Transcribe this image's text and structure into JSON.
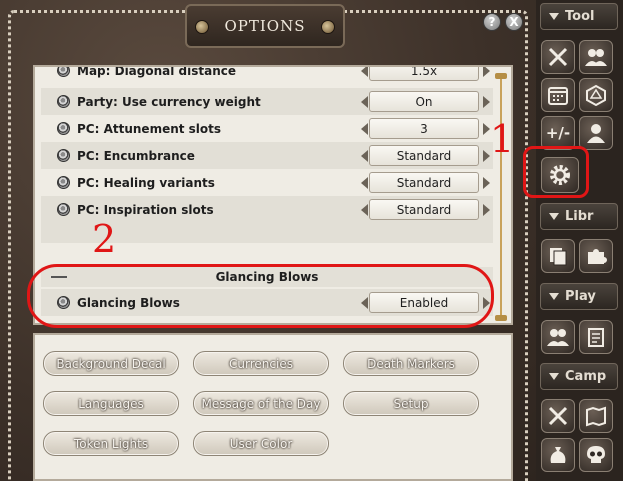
{
  "window": {
    "title": "OPTIONS",
    "help_label": "?",
    "close_label": "X"
  },
  "options_list": {
    "rows": [
      {
        "label": "Map: Diagonal distance",
        "value": "1.5x"
      },
      {
        "label": "Party: Use currency weight",
        "value": "On"
      },
      {
        "label": "PC: Attunement slots",
        "value": "3"
      },
      {
        "label": "PC: Encumbrance",
        "value": "Standard"
      },
      {
        "label": "PC: Healing variants",
        "value": "Standard"
      },
      {
        "label": "PC: Inspiration slots",
        "value": "Standard"
      }
    ],
    "group": {
      "header": "Glancing Blows",
      "row": {
        "label": "Glancing Blows",
        "value": "Enabled"
      }
    }
  },
  "buttons": [
    "Background Decal",
    "Currencies",
    "Death Markers",
    "Languages",
    "Message of the Day",
    "Setup",
    "Token Lights",
    "User Color"
  ],
  "toolbar": {
    "sections": [
      "Tool",
      "Libr",
      "Play",
      "Camp"
    ],
    "icons": {
      "tool": [
        "crossed-swords-icon",
        "party-icon",
        "calendar-icon",
        "d20-dice-icon",
        "modifier-icon",
        "character-icon",
        "settings-gear-icon"
      ],
      "libr": [
        "notes-icon",
        "puzzle-icon"
      ],
      "play": [
        "players-icon",
        "character-sheet-icon"
      ],
      "camp": [
        "combat-icon",
        "map-icon",
        "treasure-icon",
        "skull-icon"
      ]
    },
    "modifier_glyph": "+/-"
  },
  "annotations": {
    "num1": "1",
    "num2": "2",
    "color": "#e01616"
  }
}
